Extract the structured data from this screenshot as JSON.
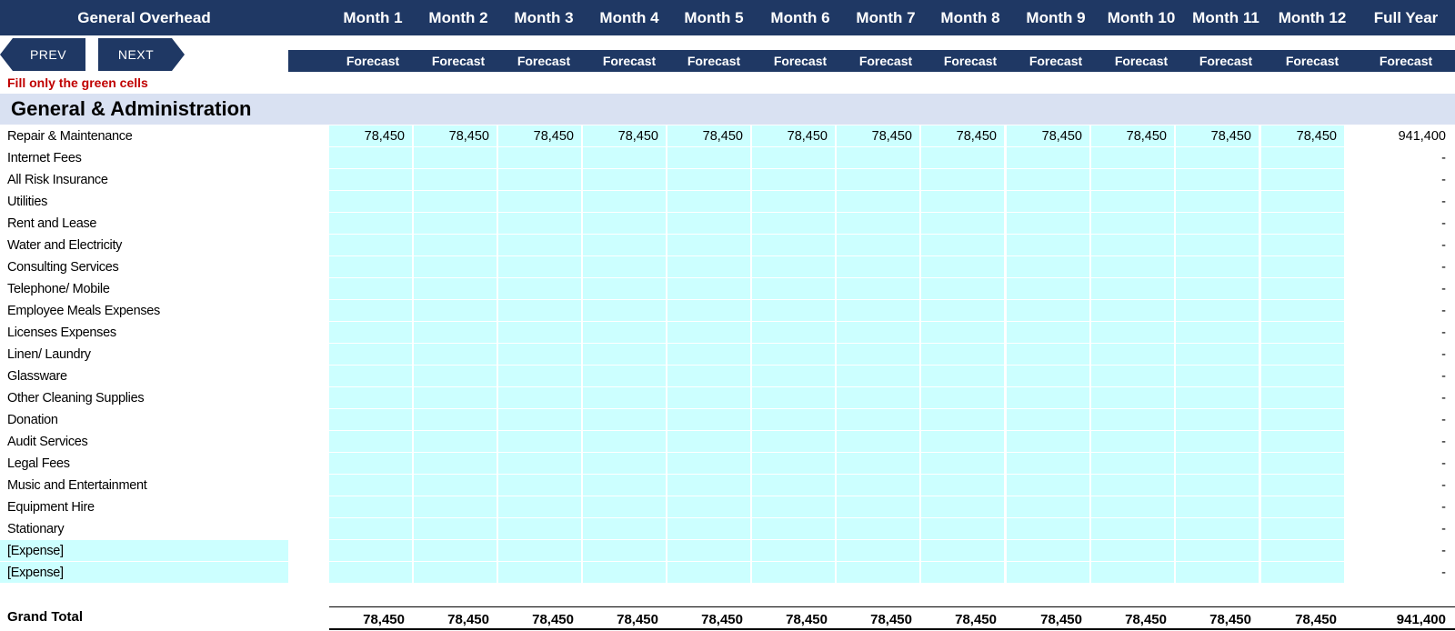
{
  "header": {
    "title": "General Overhead",
    "months": [
      "Month 1",
      "Month 2",
      "Month 3",
      "Month 4",
      "Month 5",
      "Month 6",
      "Month 7",
      "Month 8",
      "Month 9",
      "Month 10",
      "Month 11",
      "Month 12",
      "Full Year"
    ],
    "sub_label": "Forecast"
  },
  "nav": {
    "prev_label": "PREV",
    "next_label": "NEXT"
  },
  "instruction": "Fill only the green cells",
  "section_title": "General & Administration",
  "rows": [
    {
      "label": "Repair & Maintenance",
      "values": [
        "78,450",
        "78,450",
        "78,450",
        "78,450",
        "78,450",
        "78,450",
        "78,450",
        "78,450",
        "78,450",
        "78,450",
        "78,450",
        "78,450"
      ],
      "full_year": "941,400",
      "input_label": false
    },
    {
      "label": "Internet Fees",
      "values": [
        "",
        "",
        "",
        "",
        "",
        "",
        "",
        "",
        "",
        "",
        "",
        ""
      ],
      "full_year": "-",
      "input_label": false
    },
    {
      "label": "All Risk Insurance",
      "values": [
        "",
        "",
        "",
        "",
        "",
        "",
        "",
        "",
        "",
        "",
        "",
        ""
      ],
      "full_year": "-",
      "input_label": false
    },
    {
      "label": "Utilities",
      "values": [
        "",
        "",
        "",
        "",
        "",
        "",
        "",
        "",
        "",
        "",
        "",
        ""
      ],
      "full_year": "-",
      "input_label": false
    },
    {
      "label": "Rent and Lease",
      "values": [
        "",
        "",
        "",
        "",
        "",
        "",
        "",
        "",
        "",
        "",
        "",
        ""
      ],
      "full_year": "-",
      "input_label": false
    },
    {
      "label": "Water and Electricity",
      "values": [
        "",
        "",
        "",
        "",
        "",
        "",
        "",
        "",
        "",
        "",
        "",
        ""
      ],
      "full_year": "-",
      "input_label": false
    },
    {
      "label": "Consulting Services",
      "values": [
        "",
        "",
        "",
        "",
        "",
        "",
        "",
        "",
        "",
        "",
        "",
        ""
      ],
      "full_year": "-",
      "input_label": false
    },
    {
      "label": "Telephone/ Mobile",
      "values": [
        "",
        "",
        "",
        "",
        "",
        "",
        "",
        "",
        "",
        "",
        "",
        ""
      ],
      "full_year": "-",
      "input_label": false
    },
    {
      "label": "Employee Meals Expenses",
      "values": [
        "",
        "",
        "",
        "",
        "",
        "",
        "",
        "",
        "",
        "",
        "",
        ""
      ],
      "full_year": "-",
      "input_label": false
    },
    {
      "label": "Licenses Expenses",
      "values": [
        "",
        "",
        "",
        "",
        "",
        "",
        "",
        "",
        "",
        "",
        "",
        ""
      ],
      "full_year": "-",
      "input_label": false
    },
    {
      "label": "Linen/ Laundry",
      "values": [
        "",
        "",
        "",
        "",
        "",
        "",
        "",
        "",
        "",
        "",
        "",
        ""
      ],
      "full_year": "-",
      "input_label": false
    },
    {
      "label": "Glassware",
      "values": [
        "",
        "",
        "",
        "",
        "",
        "",
        "",
        "",
        "",
        "",
        "",
        ""
      ],
      "full_year": "-",
      "input_label": false
    },
    {
      "label": "Other Cleaning Supplies",
      "values": [
        "",
        "",
        "",
        "",
        "",
        "",
        "",
        "",
        "",
        "",
        "",
        ""
      ],
      "full_year": "-",
      "input_label": false
    },
    {
      "label": "Donation",
      "values": [
        "",
        "",
        "",
        "",
        "",
        "",
        "",
        "",
        "",
        "",
        "",
        ""
      ],
      "full_year": "-",
      "input_label": false
    },
    {
      "label": "Audit Services",
      "values": [
        "",
        "",
        "",
        "",
        "",
        "",
        "",
        "",
        "",
        "",
        "",
        ""
      ],
      "full_year": "-",
      "input_label": false
    },
    {
      "label": "Legal Fees",
      "values": [
        "",
        "",
        "",
        "",
        "",
        "",
        "",
        "",
        "",
        "",
        "",
        ""
      ],
      "full_year": "-",
      "input_label": false
    },
    {
      "label": "Music and Entertainment",
      "values": [
        "",
        "",
        "",
        "",
        "",
        "",
        "",
        "",
        "",
        "",
        "",
        ""
      ],
      "full_year": "-",
      "input_label": false
    },
    {
      "label": "Equipment Hire",
      "values": [
        "",
        "",
        "",
        "",
        "",
        "",
        "",
        "",
        "",
        "",
        "",
        ""
      ],
      "full_year": "-",
      "input_label": false
    },
    {
      "label": "Stationary",
      "values": [
        "",
        "",
        "",
        "",
        "",
        "",
        "",
        "",
        "",
        "",
        "",
        ""
      ],
      "full_year": "-",
      "input_label": false
    },
    {
      "label": "[Expense]",
      "values": [
        "",
        "",
        "",
        "",
        "",
        "",
        "",
        "",
        "",
        "",
        "",
        ""
      ],
      "full_year": "-",
      "input_label": true
    },
    {
      "label": "[Expense]",
      "values": [
        "",
        "",
        "",
        "",
        "",
        "",
        "",
        "",
        "",
        "",
        "",
        ""
      ],
      "full_year": "-",
      "input_label": true
    }
  ],
  "grand_total": {
    "label": "Grand Total",
    "values": [
      "78,450",
      "78,450",
      "78,450",
      "78,450",
      "78,450",
      "78,450",
      "78,450",
      "78,450",
      "78,450",
      "78,450",
      "78,450",
      "78,450"
    ],
    "full_year": "941,400"
  },
  "colors": {
    "header_bg": "#1f3864",
    "input_cell": "#ccffff",
    "section_bg": "#d9e1f2",
    "instruction": "#c00000"
  }
}
